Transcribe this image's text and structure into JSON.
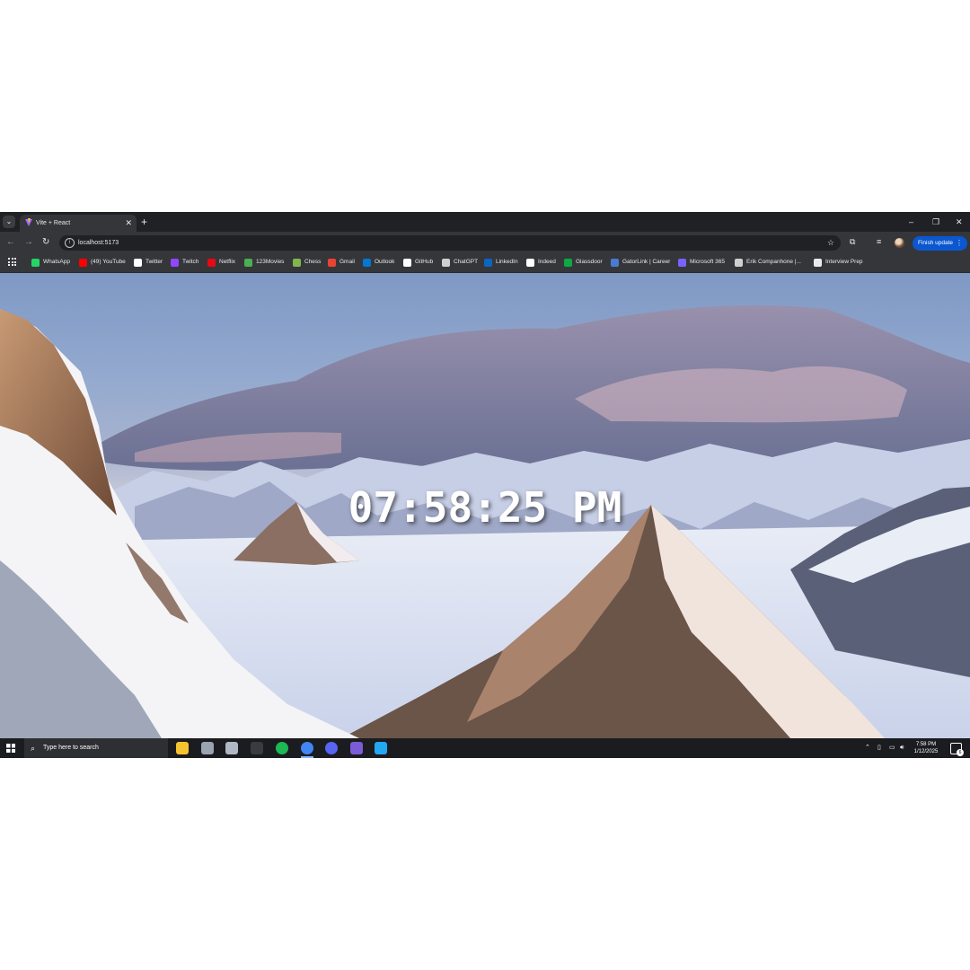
{
  "browser": {
    "tab": {
      "title": "Vite + React"
    },
    "address": {
      "url": "localhost:5173"
    },
    "update_button": {
      "label": "Finish update"
    },
    "bookmarks": [
      {
        "label": "WhatsApp",
        "color": "#25d366",
        "icon": "whatsapp-icon"
      },
      {
        "label": "(49) YouTube",
        "color": "#ff0000",
        "icon": "youtube-icon"
      },
      {
        "label": "Twitter",
        "color": "#ffffff",
        "icon": "x-icon"
      },
      {
        "label": "Twitch",
        "color": "#9146ff",
        "icon": "twitch-icon"
      },
      {
        "label": "Netflix",
        "color": "#e50914",
        "icon": "netflix-icon"
      },
      {
        "label": "123Movies",
        "color": "#4caf50",
        "icon": "play-icon"
      },
      {
        "label": "Chess",
        "color": "#81b64c",
        "icon": "pawn-icon"
      },
      {
        "label": "Gmail",
        "color": "#ea4335",
        "icon": "gmail-icon"
      },
      {
        "label": "Outlook",
        "color": "#0078d4",
        "icon": "outlook-icon"
      },
      {
        "label": "GitHub",
        "color": "#ffffff",
        "icon": "github-icon"
      },
      {
        "label": "ChatGPT",
        "color": "#cfcfcf",
        "icon": "chatgpt-icon"
      },
      {
        "label": "LinkedIn",
        "color": "#0a66c2",
        "icon": "linkedin-icon"
      },
      {
        "label": "Indeed",
        "color": "#ffffff",
        "icon": "indeed-icon"
      },
      {
        "label": "Glassdoor",
        "color": "#0caa41",
        "icon": "glassdoor-icon"
      },
      {
        "label": "GatorLink | Career",
        "color": "#4a7bd0",
        "icon": "gatorlink-icon"
      },
      {
        "label": "Microsoft 365",
        "color": "#7b61ff",
        "icon": "microsoft365-icon"
      },
      {
        "label": "Erik Companhone |...",
        "color": "#cfcfcf",
        "icon": "globe-icon"
      },
      {
        "label": "Interview Prep",
        "color": "#e8eaed",
        "icon": "folder-icon"
      }
    ]
  },
  "page": {
    "clock": "07:58:25 PM"
  },
  "taskbar": {
    "search_placeholder": "Type here to search",
    "apps": [
      {
        "name": "file-explorer-icon",
        "color": "#f4c430"
      },
      {
        "name": "app-icon-2",
        "color": "#9aa3b0"
      },
      {
        "name": "shield-app-icon",
        "color": "#b0b8c4"
      },
      {
        "name": "speedometer-app-icon",
        "color": "#3a3b40"
      },
      {
        "name": "spotify-icon",
        "color": "#1db954"
      },
      {
        "name": "chrome-icon",
        "color": "#4285f4"
      },
      {
        "name": "discord-icon",
        "color": "#5865f2"
      },
      {
        "name": "obsidian-icon",
        "color": "#7c5cd6"
      },
      {
        "name": "vscode-icon",
        "color": "#23a8f2"
      }
    ],
    "clock": {
      "time": "7:58 PM",
      "date": "1/12/2025"
    },
    "notification_count": "6"
  }
}
